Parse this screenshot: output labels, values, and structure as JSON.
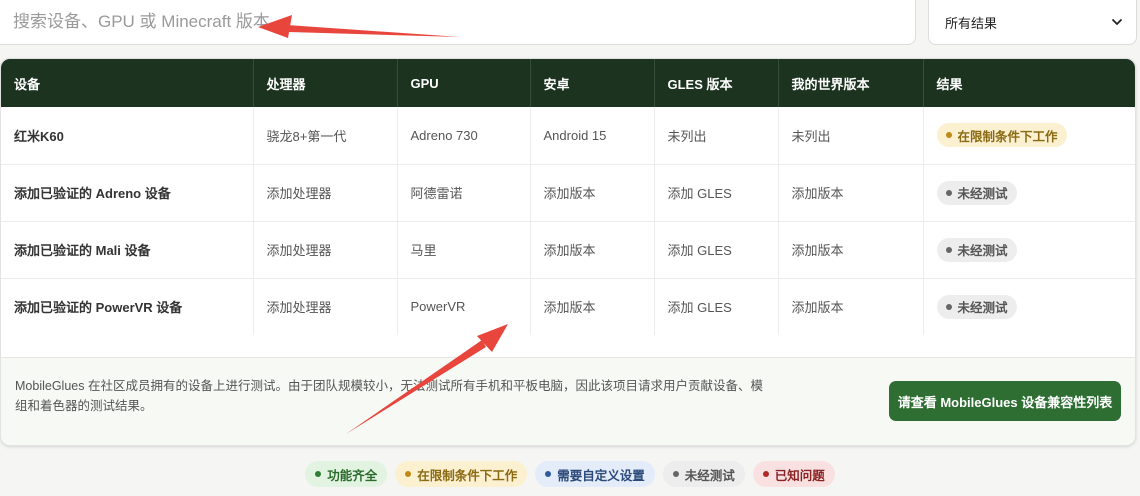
{
  "search": {
    "placeholder": "搜索设备、GPU 或 Minecraft 版本"
  },
  "filter": {
    "selected": "所有结果"
  },
  "table": {
    "headers": [
      "设备",
      "处理器",
      "GPU",
      "安卓",
      "GLES 版本",
      "我的世界版本",
      "结果"
    ],
    "rows": [
      {
        "device": "红米K60",
        "cpu": "骁龙8+第一代",
        "gpu": "Adreno 730",
        "android": "Android 15",
        "gles": "未列出",
        "mc": "未列出",
        "result": "在限制条件下工作",
        "status": "limited"
      },
      {
        "device": "添加已验证的 Adreno 设备",
        "cpu": "添加处理器",
        "gpu": "阿德雷诺",
        "android": "添加版本",
        "gles": "添加 GLES",
        "mc": "添加版本",
        "result": "未经测试",
        "status": "untested"
      },
      {
        "device": "添加已验证的 Mali 设备",
        "cpu": "添加处理器",
        "gpu": "马里",
        "android": "添加版本",
        "gles": "添加 GLES",
        "mc": "添加版本",
        "result": "未经测试",
        "status": "untested"
      },
      {
        "device": "添加已验证的 PowerVR 设备",
        "cpu": "添加处理器",
        "gpu": "PowerVR",
        "android": "添加版本",
        "gles": "添加 GLES",
        "mc": "添加版本",
        "result": "未经测试",
        "status": "untested"
      }
    ]
  },
  "footer": {
    "text": "MobileGlues 在社区成员拥有的设备上进行测试。由于团队规模较小，无法测试所有手机和平板电脑，因此该项目请求用户贡献设备、模组和着色器的测试结果。",
    "button": "请查看 MobileGlues 设备兼容性列表"
  },
  "legend": [
    {
      "label": "功能齐全",
      "status": "full"
    },
    {
      "label": "在限制条件下工作",
      "status": "limited"
    },
    {
      "label": "需要自定义设置",
      "status": "custom"
    },
    {
      "label": "未经测试",
      "status": "untested"
    },
    {
      "label": "已知问题",
      "status": "issue"
    }
  ],
  "colors": {
    "header_bg": "#1c3320",
    "button_bg": "#2e6e33",
    "annotation_arrow": "#e8453c"
  }
}
